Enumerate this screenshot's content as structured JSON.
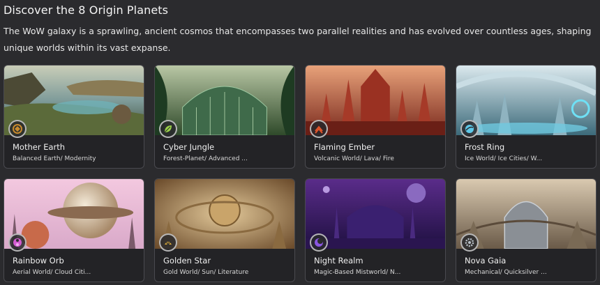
{
  "header": {
    "title": "Discover the 8 Origin Planets",
    "intro": "The WoW galaxy is a sprawling, ancient cosmos that encompasses two parallel realities and has evolved over countless ages, shaping unique worlds within its vast expanse."
  },
  "planets": [
    {
      "name": "Mother Earth",
      "subtitle": "Balanced Earth/ Modernity",
      "icon": "earth-emblem-icon",
      "accent": "#c88a2e"
    },
    {
      "name": "Cyber Jungle",
      "subtitle": "Forest-Planet/ Advanced ...",
      "icon": "leaf-emblem-icon",
      "accent": "#9bd24a"
    },
    {
      "name": "Flaming Ember",
      "subtitle": "Volcanic World/ Lava/ Fire",
      "icon": "flame-emblem-icon",
      "accent": "#e0552b"
    },
    {
      "name": "Frost Ring",
      "subtitle": "Ice World/ Ice Cities/ W...",
      "icon": "ring-emblem-icon",
      "accent": "#5fc8e8"
    },
    {
      "name": "Rainbow Orb",
      "subtitle": "Aerial World/ Cloud Citi...",
      "icon": "orb-emblem-icon",
      "accent": "#d35bd0"
    },
    {
      "name": "Golden Star",
      "subtitle": "Gold World/ Sun/ Literature",
      "icon": "star-emblem-icon",
      "accent": "#d4a53a"
    },
    {
      "name": "Night Realm",
      "subtitle": "Magic-Based Mistworld/ N...",
      "icon": "moon-emblem-icon",
      "accent": "#8a56e0"
    },
    {
      "name": "Nova Gaia",
      "subtitle": "Mechanical/ Quicksilver ...",
      "icon": "gear-emblem-icon",
      "accent": "#b8c0c8"
    }
  ]
}
